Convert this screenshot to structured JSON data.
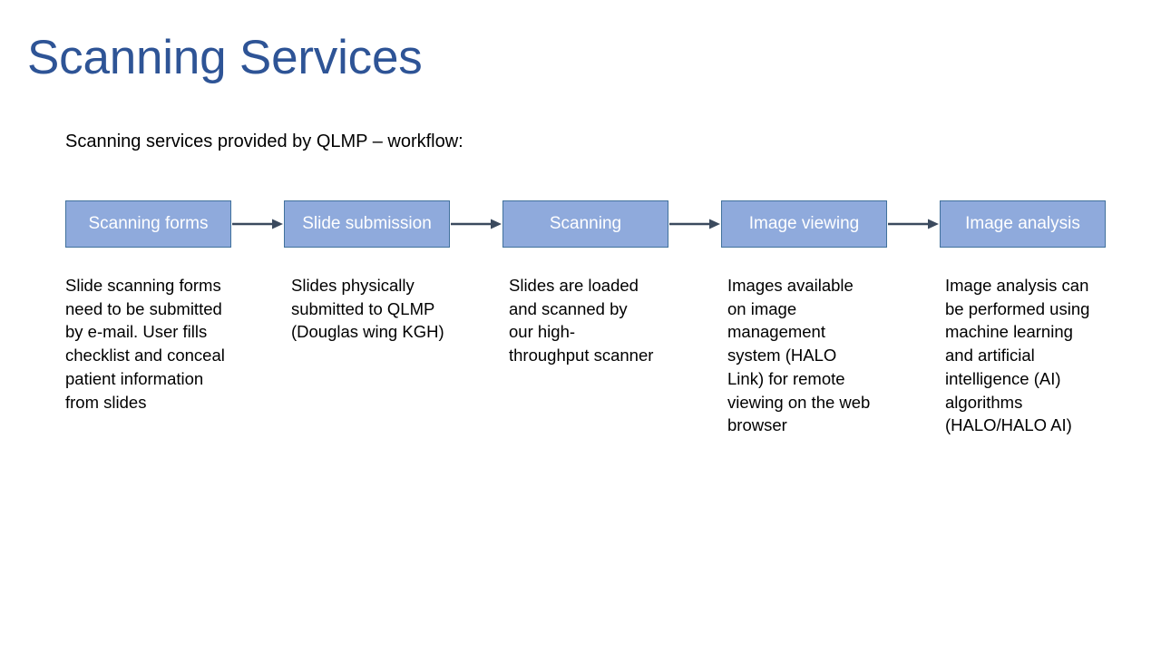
{
  "slide": {
    "title": "Scanning Services",
    "subtitle": "Scanning services provided by QLMP – workflow:",
    "title_color": "#2E5496",
    "box_fill_color": "#8FAADC",
    "box_border_color": "#41719C",
    "box_text_color": "#FFFFFF",
    "arrow_color": "#3B4A5E",
    "background_color": "#FFFFFF"
  },
  "workflow": {
    "steps": [
      {
        "label": "Scanning forms",
        "description": "Slide scanning forms need to be submitted by e-mail. User fills checklist and conceal patient information from slides"
      },
      {
        "label": "Slide submission",
        "description": "Slides physically submitted to QLMP (Douglas wing KGH)"
      },
      {
        "label": "Scanning",
        "description": "Slides are loaded and scanned by our high-throughput scanner"
      },
      {
        "label": "Image viewing",
        "description": "Images available on image management system (HALO Link) for remote viewing on the web browser"
      },
      {
        "label": "Image analysis",
        "description": "Image analysis can be performed using machine learning and artificial intelligence (AI) algorithms (HALO/HALO AI)"
      }
    ],
    "connectors": [
      {
        "name": "arrow-1-to-2"
      },
      {
        "name": "arrow-2-to-3"
      },
      {
        "name": "arrow-3-to-4"
      },
      {
        "name": "arrow-4-to-5"
      }
    ]
  }
}
